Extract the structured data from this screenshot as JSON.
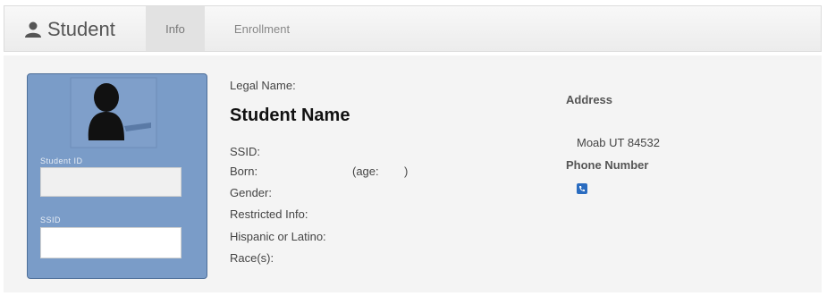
{
  "header": {
    "brand": "Student",
    "tabs": [
      {
        "label": "Info",
        "active": true
      },
      {
        "label": "Enrollment",
        "active": false
      }
    ]
  },
  "card": {
    "field1_label": "Student ID",
    "field2_label": "SSID"
  },
  "details": {
    "legal_name_label": "Legal Name:",
    "student_name": "Student Name",
    "ssid_label": "SSID:",
    "born_label": "Born:",
    "age_label": "(age:",
    "age_close": ")",
    "gender_label": "Gender:",
    "restricted_label": "Restricted Info:",
    "hispanic_label": "Hispanic or Latino:",
    "race_label": "Race(s):"
  },
  "contact": {
    "address_heading": "Address",
    "address_line": "Moab UT 84532",
    "phone_heading": "Phone Number",
    "phone_icon": "phone-icon"
  },
  "colors": {
    "card_bg": "#7a9cc8",
    "accent": "#2a6cc0"
  }
}
